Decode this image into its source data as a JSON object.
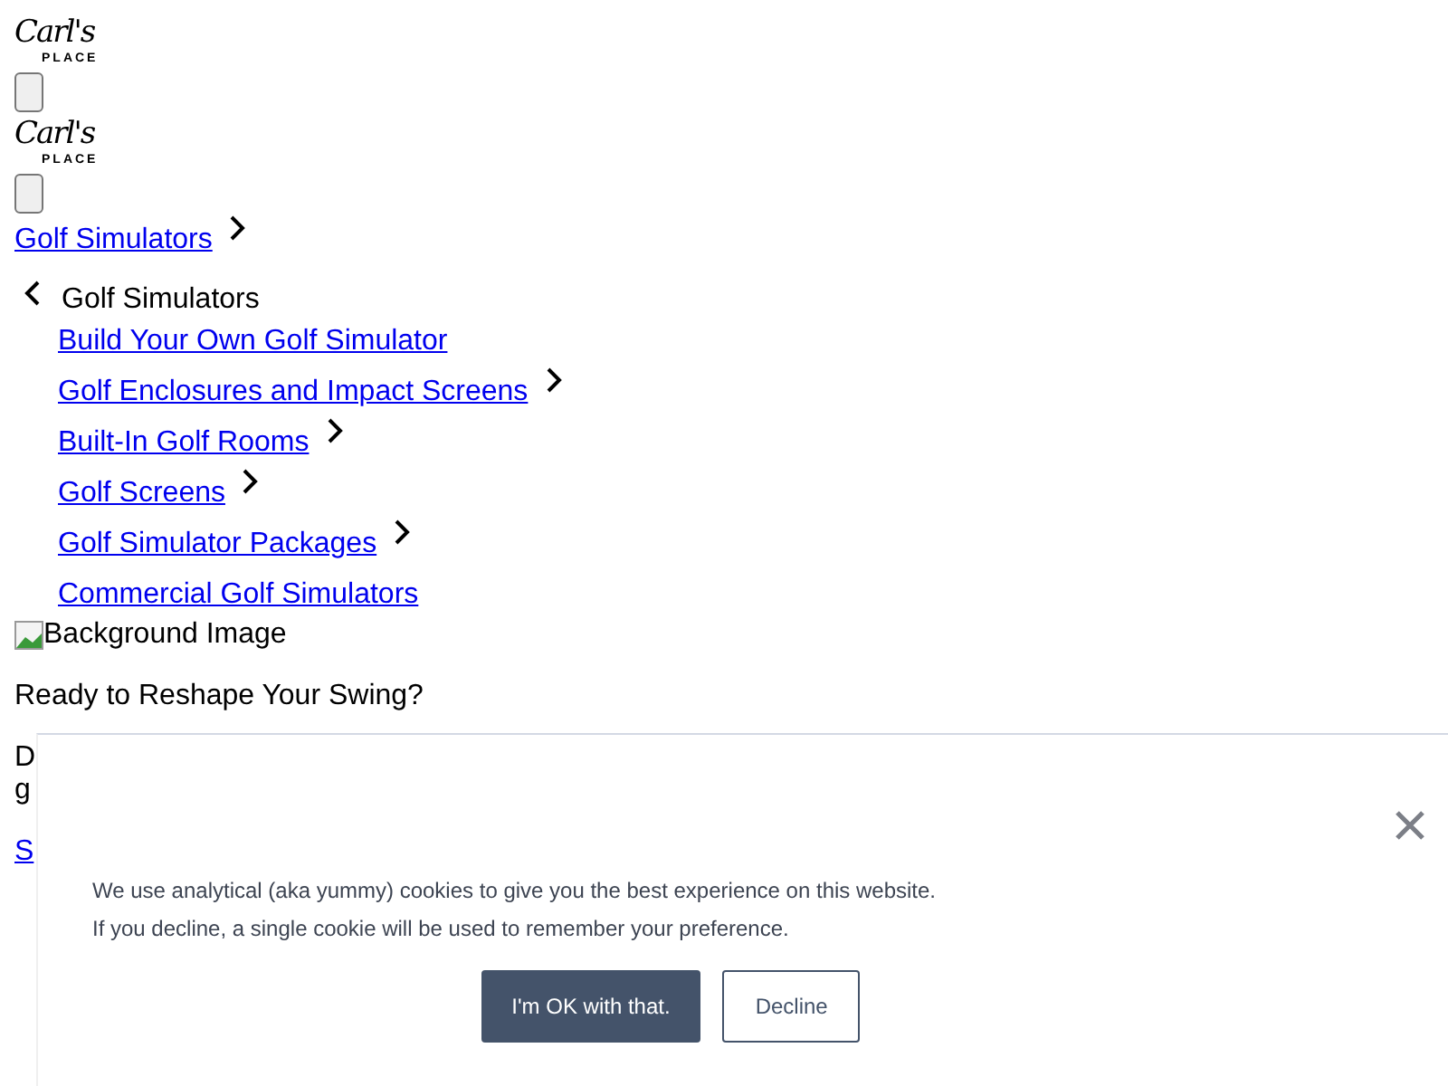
{
  "header": {
    "logos": [
      {
        "name": "Carl's",
        "sub": "PLACE"
      },
      {
        "name": "Carl's",
        "sub": "PLACE"
      }
    ]
  },
  "nav": {
    "top": {
      "label": "Golf Simulators",
      "has_children": true
    },
    "submenu": {
      "title": "Golf Simulators",
      "items": [
        {
          "label": "Build Your Own Golf Simulator",
          "has_children": false
        },
        {
          "label": "Golf Enclosures and Impact Screens",
          "has_children": true
        },
        {
          "label": "Built-In Golf Rooms",
          "has_children": true
        },
        {
          "label": "Golf Screens",
          "has_children": true
        },
        {
          "label": "Golf Simulator Packages",
          "has_children": true
        },
        {
          "label": "Commercial Golf Simulators",
          "has_children": false
        }
      ]
    }
  },
  "hero": {
    "image_alt": "Background Image",
    "heading": "Ready to Reshape Your Swing?",
    "text_lines": [
      "D",
      "g"
    ],
    "link": "S"
  },
  "cookie_banner": {
    "lines": [
      "We use analytical (aka yummy) cookies to give you the best experience on this website.",
      "If you decline, a single cookie will be used to remember your preference."
    ],
    "buttons": [
      {
        "label": "I'm OK with that.",
        "kind": "primary"
      },
      {
        "label": "Decline",
        "kind": "secondary"
      }
    ]
  }
}
